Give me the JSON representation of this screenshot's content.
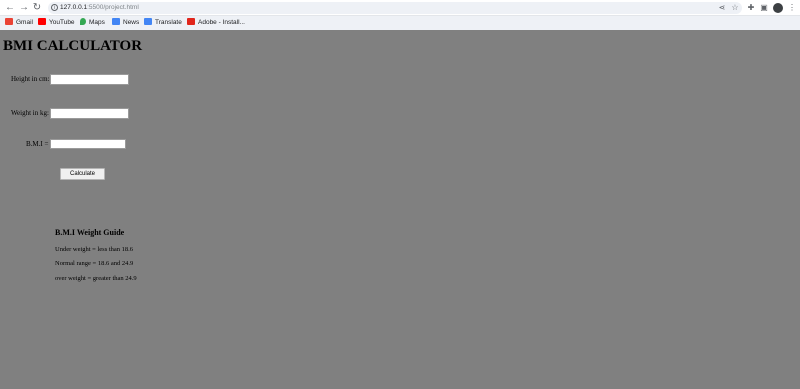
{
  "browser": {
    "url_host": "127.0.0.1",
    "url_rest": ":5500/project.html",
    "bookmarks": [
      {
        "label": "Gmail",
        "color": "#ea4335"
      },
      {
        "label": "YouTube",
        "color": "#ff0000"
      },
      {
        "label": "Maps",
        "color": "#34a853"
      },
      {
        "label": "News",
        "color": "#4285f4"
      },
      {
        "label": "Translate",
        "color": "#4285f4"
      },
      {
        "label": "Adobe - Install...",
        "color": "#e1251b"
      }
    ]
  },
  "page": {
    "title": "BMI CALCULATOR",
    "height_label": "Height in cm:",
    "height_value": "",
    "weight_label": "Weight in kg:",
    "weight_value": "",
    "bmi_label": "B.M.I =",
    "bmi_value": "",
    "calculate_label": "Calculate",
    "guide": {
      "title": "B.M.I Weight Guide",
      "items": [
        "Under weight = less than 18.6",
        "Normal range = 18.6 and 24.9",
        "over weight = greater than 24.9"
      ]
    }
  }
}
